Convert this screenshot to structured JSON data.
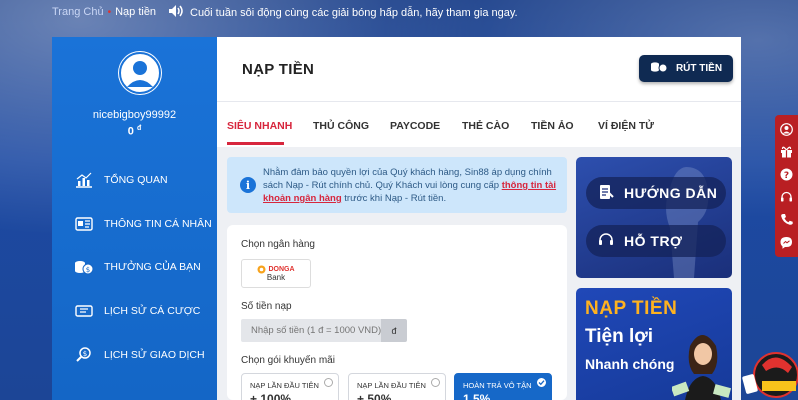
{
  "breadcrumb": {
    "home": "Trang Chủ",
    "current": "Nạp tiền"
  },
  "announcement": "Cuối tuần sôi động cùng các giải bóng hấp dẫn, hãy tham gia ngay.",
  "user": {
    "username": "nicebigboy99992",
    "balance": "0",
    "currency_symbol": "đ"
  },
  "sidebar": {
    "items": [
      {
        "label": "TỔNG QUAN",
        "icon": "chart-icon"
      },
      {
        "label": "THÔNG TIN CÁ NHÂN",
        "icon": "id-card-icon"
      },
      {
        "label": "THƯỞNG CỦA BẠN",
        "icon": "coins-icon"
      },
      {
        "label": "LỊCH SỬ CÁ CƯỢC",
        "icon": "ticket-icon"
      },
      {
        "label": "LỊCH SỬ GIAO DỊCH",
        "icon": "search-money-icon"
      }
    ]
  },
  "header": {
    "title": "NẠP TIỀN",
    "withdraw_label": "RÚT TIỀN"
  },
  "tabs": [
    "SIÊU NHANH",
    "THỦ CÔNG",
    "PAYCODE",
    "THẺ CÀO",
    "TIỀN ẢO",
    "VÍ ĐIỆN TỬ"
  ],
  "notice": {
    "text_before": "Nhằm đảm bảo quyền lợi của Quý khách hàng, Sin88 áp dụng chính sách Nạp - Rút chính chủ. Quý Khách vui lòng cung cấp ",
    "link": "thông tin tài khoản ngân hàng",
    "text_after": " trước khi Nạp - Rút tiền."
  },
  "form": {
    "bank_label": "Chọn ngân hàng",
    "bank_name_top": "DONGA",
    "bank_name_bottom": "Bank",
    "amount_label": "Số tiền nạp",
    "amount_placeholder": "Nhập số tiền (1 đ = 1000 VND)",
    "amount_unit": "đ",
    "promo_label": "Chọn gói khuyến mãi",
    "promos": [
      {
        "title": "NẠP LẦN ĐẦU TIÊN",
        "value": "+ 100%",
        "selected": false
      },
      {
        "title": "NẠP LẦN ĐẦU TIÊN",
        "value": "+ 50%",
        "selected": false
      },
      {
        "title": "HOÀN TRẢ VÔ TẬN",
        "value": "1,5%",
        "selected": true
      }
    ]
  },
  "help": {
    "guide_label": "HƯỚNG DẪN",
    "support_label": "HỖ TRỢ"
  },
  "banner": {
    "line1": "NẠP TIỀN",
    "line2": "Tiện lợi",
    "line3": "Nhanh chóng"
  },
  "dock_icons": [
    "user-icon",
    "gift-icon",
    "question-icon",
    "headset-icon",
    "phone-icon",
    "messenger-icon"
  ],
  "colors": {
    "accent_red": "#d7263d",
    "sidebar_blue": "#1a73d8",
    "navy": "#0f2a52",
    "banner_gold": "#ffb21f"
  }
}
